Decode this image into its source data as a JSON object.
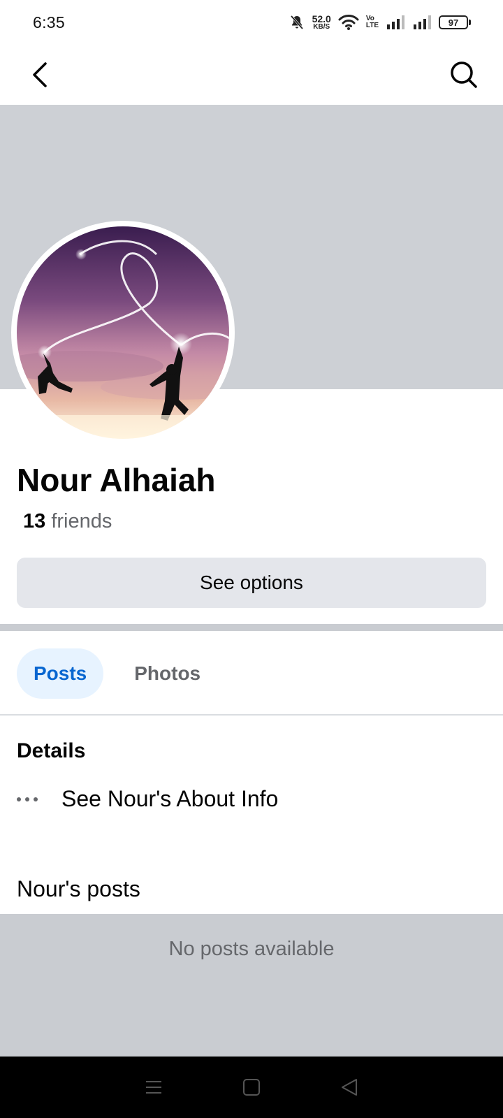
{
  "status_bar": {
    "time": "6:35",
    "net_speed": "52.0",
    "net_unit": "KB/S",
    "volte_top": "Vo",
    "volte_bottom": "LTE",
    "battery": "97"
  },
  "nav": {
    "back_icon": "back-arrow-icon",
    "search_icon": "search-icon"
  },
  "profile": {
    "name": "Nour Alhaiah",
    "friends_count": "13",
    "friends_label": "friends",
    "avatar_icon": "profile-photo"
  },
  "actions": {
    "see_options": "See options"
  },
  "tabs": [
    {
      "label": "Posts",
      "active": true
    },
    {
      "label": "Photos",
      "active": false
    }
  ],
  "details": {
    "heading": "Details",
    "about_label": "See Nour's About Info"
  },
  "posts": {
    "heading": "Nour's posts",
    "empty_text": "No posts available"
  },
  "colors": {
    "accent": "#0866d0",
    "tab_active_bg": "#e7f3ff",
    "cover_bg": "#cdd0d5",
    "button_bg": "#e4e6eb"
  }
}
